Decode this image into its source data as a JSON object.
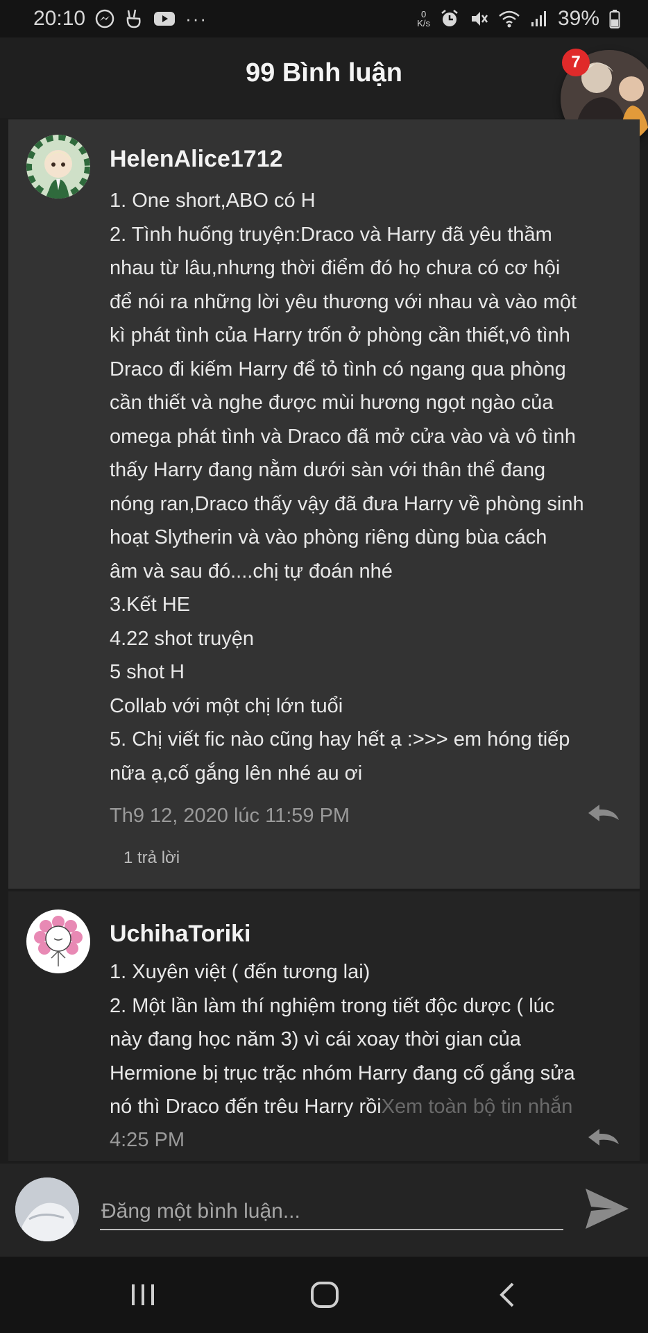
{
  "status_bar": {
    "time": "20:10",
    "net_speed_value": "0",
    "net_speed_unit": "K/s",
    "battery": "39%",
    "more": "···"
  },
  "header": {
    "title": "99 Bình luận",
    "chathead_badge": "7"
  },
  "comments": [
    {
      "user": "HelenAlice1712",
      "lines": [
        "1. One short,ABO có H",
        "2. Tình huống truyện:Draco và Harry đã yêu thầm",
        "nhau từ lâu,nhưng thời điểm đó họ chưa có cơ hội",
        "để nói ra những lời yêu thương với nhau và vào một",
        "kì phát tình của Harry trốn ở phòng cần thiết,vô tình",
        "Draco đi kiếm Harry để tỏ tình có ngang qua phòng",
        "cần thiết và nghe được mùi hương ngọt ngào của",
        "omega phát tình và Draco đã mở cửa vào và vô tình",
        "thấy Harry đang nằm dưới sàn với thân thể đang",
        "nóng ran,Draco thấy vậy đã đưa Harry về phòng sinh",
        "hoạt Slytherin và vào phòng riêng dùng bùa cách",
        "âm và sau đó....chị tự đoán nhé",
        "3.Kết HE",
        "4.22 shot truyện",
        "5 shot H",
        "Collab với một chị lớn tuổi",
        "5. Chị viết fic nào cũng hay hết ạ :>>> em hóng tiếp",
        "nữa ạ,cố gắng lên nhé au ơi"
      ],
      "timestamp": "Th9 12, 2020 lúc 11:59 PM",
      "replies": "1 trả lời"
    },
    {
      "user": "UchihaToriki",
      "lines": [
        "1. Xuyên việt ( đến tương lai)",
        "2. Một lần làm thí nghiệm trong tiết độc dược ( lúc",
        "này đang học năm 3) vì cái xoay thời gian của",
        "Hermione bị trục trặc nhóm Harry đang cố gắng sửa"
      ],
      "last_line": "nó thì Draco đến trêu Harry rồi",
      "see_more": "Xem toàn bộ tin nhắn",
      "timestamp": "4:25 PM"
    }
  ],
  "composer": {
    "placeholder": "Đăng một bình luận..."
  },
  "colors": {
    "background": "#1c1c1c",
    "comment_bg": "#333333",
    "badge": "#e02a2a"
  }
}
